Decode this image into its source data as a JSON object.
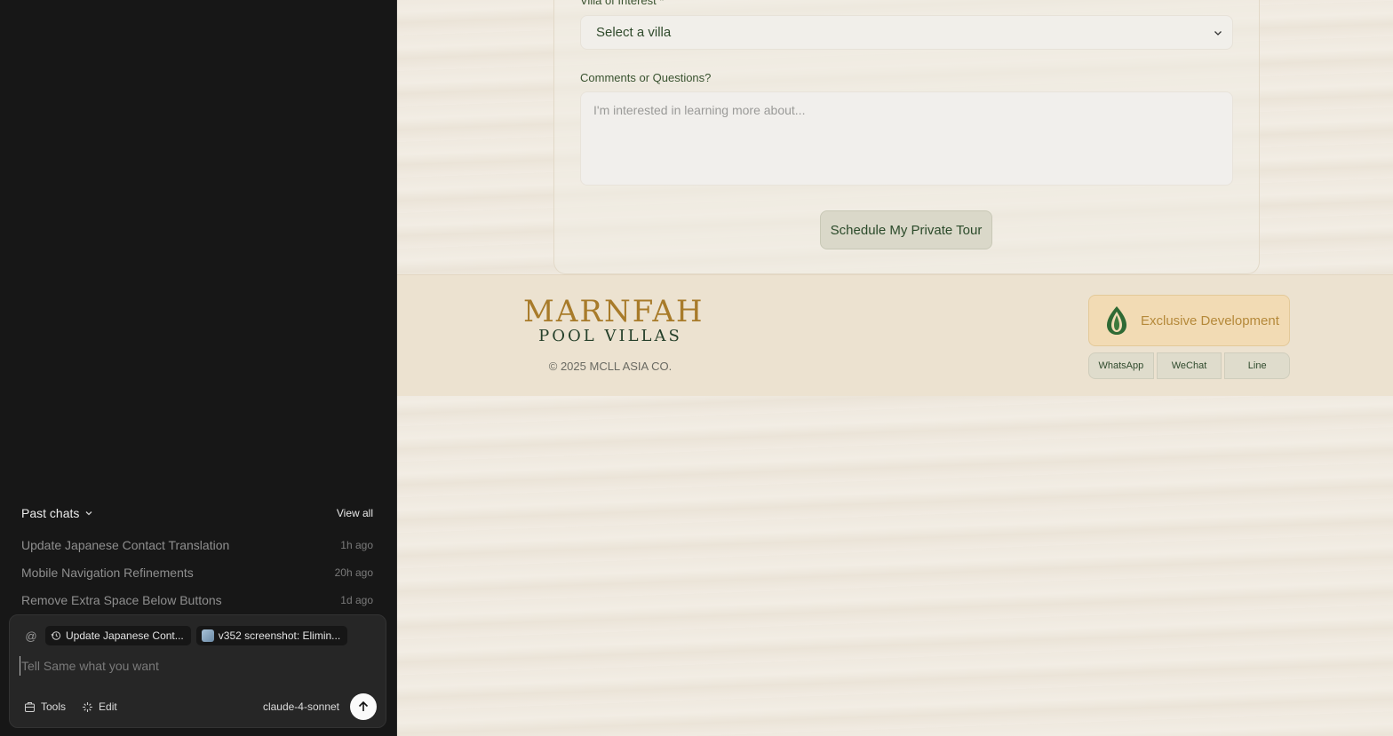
{
  "sidebar": {
    "past_chats_label": "Past chats",
    "view_all_label": "View all",
    "chats": [
      {
        "title": "Update Japanese Contact Translation",
        "time": "1h ago"
      },
      {
        "title": "Mobile Navigation Refinements",
        "time": "20h ago"
      },
      {
        "title": "Remove Extra Space Below Buttons",
        "time": "1d ago"
      }
    ],
    "composer": {
      "at_symbol": "@",
      "context_chips": [
        {
          "label": "Update Japanese Cont...",
          "icon": "history-icon"
        },
        {
          "label": "v352 screenshot: Elimin...",
          "icon": "image-thumbnail"
        }
      ],
      "placeholder": "Tell Same what you want",
      "tools_label": "Tools",
      "edit_label": "Edit",
      "model": "claude-4-sonnet",
      "send_icon": "arrow-up-icon"
    }
  },
  "preview": {
    "form": {
      "villa_label": "Villa of Interest *",
      "villa_select_value": "Select a villa",
      "comments_label": "Comments or Questions?",
      "comments_placeholder": "I'm interested in learning more about...",
      "submit_label": "Schedule My Private Tour"
    },
    "footer": {
      "logo_main": "MARNFAH",
      "logo_sub": "POOL VILLAS",
      "copyright": "© 2025 MCLL ASIA CO.",
      "exclusive_label": "Exclusive Development",
      "social": [
        "WhatsApp",
        "WeChat",
        "Line"
      ]
    },
    "colors": {
      "brand_gold": "#a87b2a",
      "brand_green": "#25402a",
      "background": "#efe9df"
    }
  }
}
